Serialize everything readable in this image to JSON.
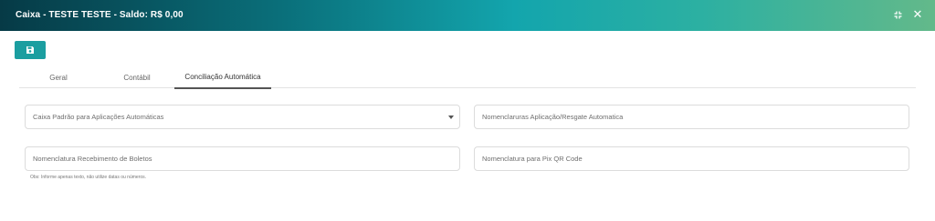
{
  "header": {
    "title": "Caixa - TESTE TESTE - Saldo: R$ 0,00",
    "expand_icon": "expand-icon",
    "close_label": "✕"
  },
  "toolbar": {
    "save_icon": "floppy-disk-icon"
  },
  "tabs": [
    {
      "label": "Geral",
      "active": false
    },
    {
      "label": "Contábil",
      "active": false
    },
    {
      "label": "Conciliação Automática",
      "active": true
    }
  ],
  "form": {
    "default_cash": {
      "label": "Caixa Padrão para Aplicações Automáticas",
      "type": "select"
    },
    "application_nomenclature": {
      "label": "Nomenclaruras Aplicação/Resgate Automatica"
    },
    "boleto_nomenclature": {
      "label": "Nomenclatura Recebimento de Boletos"
    },
    "pix_nomenclature": {
      "label": "Nomenclatura para Pix QR Code"
    },
    "hint": "Obs: Informe apenas texto, não utilize datas ou números."
  },
  "colors": {
    "accent": "#1b9ea0",
    "header_start": "#063a46",
    "header_end": "#63b98a"
  }
}
